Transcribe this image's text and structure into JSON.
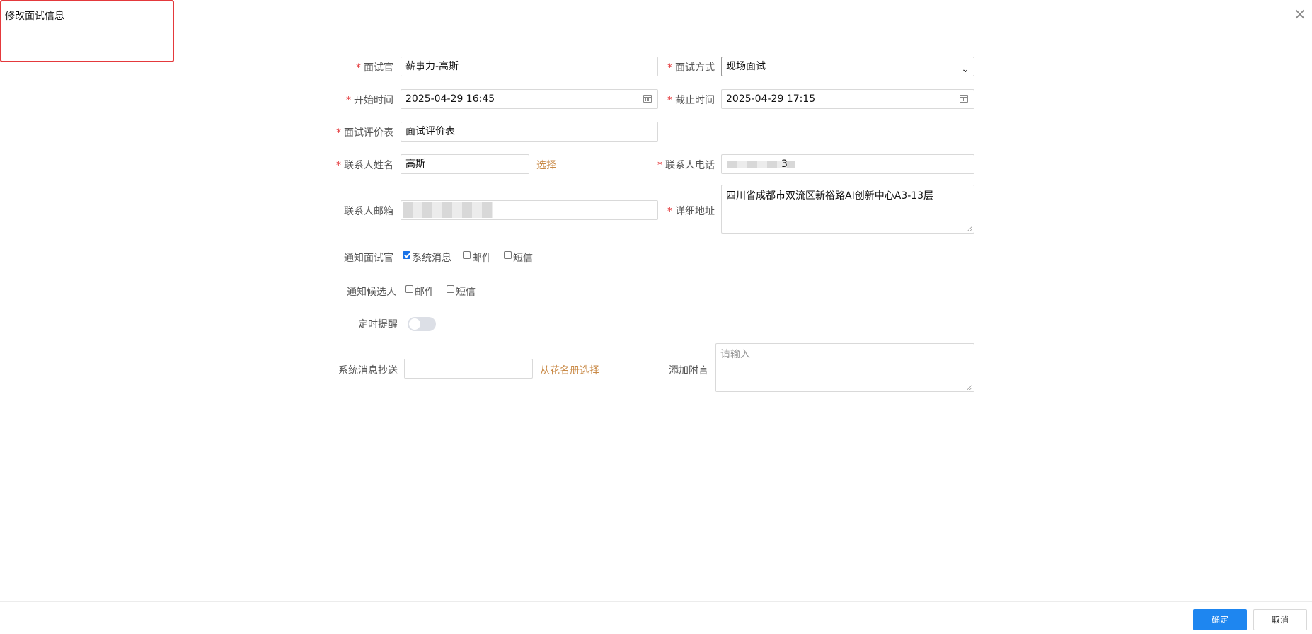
{
  "dialog": {
    "title": "修改面试信息"
  },
  "required_mark": "*",
  "fields": {
    "interviewer": {
      "label": "面试官",
      "value": "薪事力-高斯"
    },
    "method": {
      "label": "面试方式",
      "value": "现场面试"
    },
    "start_time": {
      "label": "开始时间",
      "value": "2025-04-29 16:45"
    },
    "end_time": {
      "label": "截止时间",
      "value": "2025-04-29 17:15"
    },
    "evaluation": {
      "label": "面试评价表",
      "value": "面试评价表"
    },
    "contact_name": {
      "label": "联系人姓名",
      "value": "高斯",
      "select_label": "选择"
    },
    "contact_phone": {
      "label": "联系人电话",
      "value_suffix": "3"
    },
    "contact_email": {
      "label": "联系人邮箱"
    },
    "address": {
      "label": "详细地址",
      "value": "四川省成都市双流区新裕路AI创新中心A3-13层"
    },
    "notify_interviewer": {
      "label": "通知面试官",
      "options": [
        {
          "label": "系统消息",
          "checked": true
        },
        {
          "label": "邮件",
          "checked": false
        },
        {
          "label": "短信",
          "checked": false
        }
      ]
    },
    "notify_candidate": {
      "label": "通知候选人",
      "options": [
        {
          "label": "邮件",
          "checked": false
        },
        {
          "label": "短信",
          "checked": false
        }
      ]
    },
    "timed_reminder": {
      "label": "定时提醒",
      "enabled": false
    },
    "cc": {
      "label": "系统消息抄送",
      "value": "",
      "link": "从花名册选择"
    },
    "note": {
      "label": "添加附言",
      "placeholder": "请输入"
    }
  },
  "footer": {
    "confirm": "确定",
    "cancel": "取消"
  },
  "colors": {
    "primary": "#1e86f0",
    "required": "#e4393c",
    "link": "#c98a47",
    "highlight_box": "#e4393c"
  },
  "icons": {
    "close": "close-icon",
    "calendar": "calendar-icon",
    "dropdown": "chevron-down-icon"
  }
}
